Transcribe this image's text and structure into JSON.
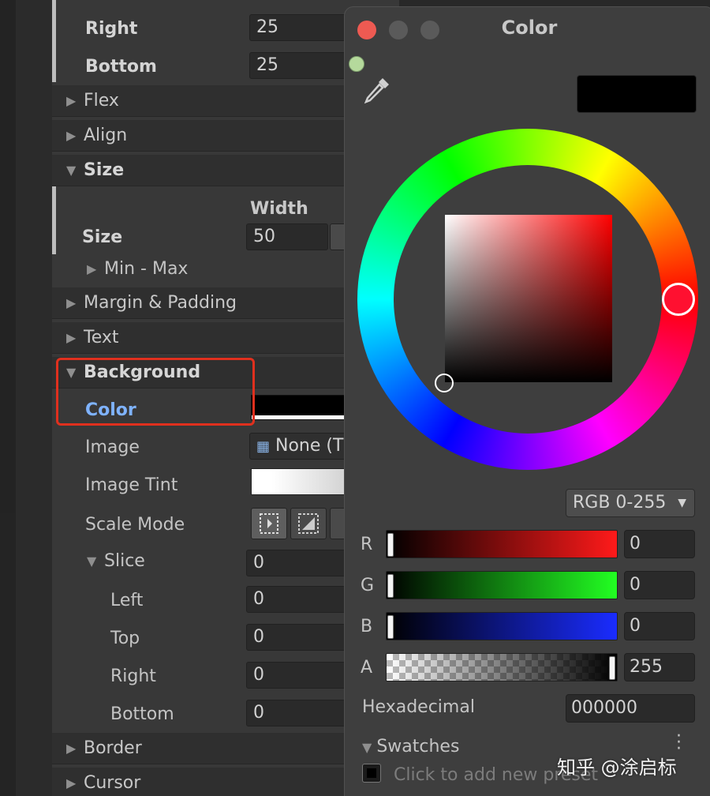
{
  "inspector": {
    "right_label": "Right",
    "right_value": "25",
    "bottom_label": "Bottom",
    "bottom_value": "25",
    "flex": "Flex",
    "align": "Align",
    "size_foldout": "Size",
    "width_header": "Width",
    "size_label": "Size",
    "size_value": "50",
    "min_max": "Min - Max",
    "margin_padding": "Margin & Padding",
    "text": "Text",
    "background": "Background",
    "color_label": "Color",
    "image_label": "Image",
    "image_value": "None (T",
    "image_tint": "Image Tint",
    "scale_mode": "Scale Mode",
    "slice": "Slice",
    "slice_value": "0",
    "left_label": "Left",
    "left_value": "0",
    "top_label": "Top",
    "top_value": "0",
    "slice_right_label": "Right",
    "slice_right_value": "0",
    "slice_bottom_label": "Bottom",
    "slice_bottom_value": "0",
    "border": "Border",
    "cursor": "Cursor"
  },
  "color_window": {
    "title": "Color",
    "mode": "RGB 0-255",
    "r_label": "R",
    "r_value": "0",
    "g_label": "G",
    "g_value": "0",
    "b_label": "B",
    "b_value": "0",
    "a_label": "A",
    "a_value": "255",
    "hex_label": "Hexadecimal",
    "hex_value": "000000",
    "swatches": "Swatches",
    "preset_hint": "Click to add new preset",
    "preview_color": "#000000"
  },
  "watermark": "知乎 @涂启标",
  "colors": {
    "highlight": "#e0301e",
    "accent_label": "#7fb3ff",
    "panel": "#383838"
  }
}
